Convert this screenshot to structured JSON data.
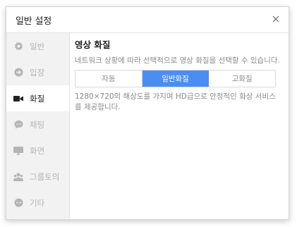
{
  "dialog": {
    "title": "일반 설정"
  },
  "sidebar": {
    "items": [
      {
        "label": "일반",
        "icon": "gear-icon"
      },
      {
        "label": "입장",
        "icon": "enter-arrow-icon"
      },
      {
        "label": "화질",
        "icon": "video-camera-icon",
        "active": true
      },
      {
        "label": "채팅",
        "icon": "chat-bubble-icon"
      },
      {
        "label": "화면",
        "icon": "monitor-icon"
      },
      {
        "label": "그룹토의",
        "icon": "group-icon"
      },
      {
        "label": "기타",
        "icon": "more-dots-icon"
      }
    ]
  },
  "main": {
    "section_title": "영상 화질",
    "description": "네트워크 상황에 따라 선택적으로 영상 화질을 선택할 수 있습니다.",
    "quality_options": [
      {
        "label": "자동"
      },
      {
        "label": "일반화질",
        "selected": true
      },
      {
        "label": "고화질"
      }
    ],
    "info": "1280×720의 해상도를 가지며 HD급으로 안정적인 화상 서비스를 제공합니다."
  },
  "colors": {
    "accent": "#4a8ef3",
    "sidebar_bg": "#f2f2f2"
  }
}
